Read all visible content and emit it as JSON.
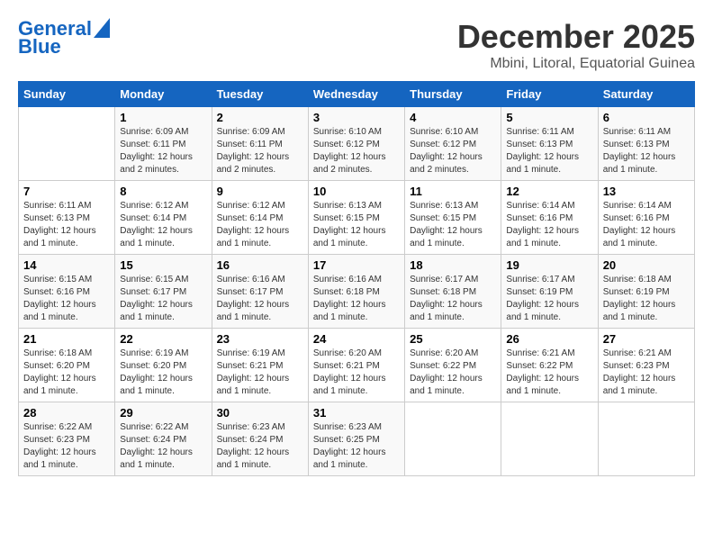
{
  "logo": {
    "line1": "General",
    "line2": "Blue"
  },
  "title": "December 2025",
  "location": "Mbini, Litoral, Equatorial Guinea",
  "weekdays": [
    "Sunday",
    "Monday",
    "Tuesday",
    "Wednesday",
    "Thursday",
    "Friday",
    "Saturday"
  ],
  "weeks": [
    [
      {
        "day": "",
        "info": ""
      },
      {
        "day": "1",
        "info": "Sunrise: 6:09 AM\nSunset: 6:11 PM\nDaylight: 12 hours\nand 2 minutes."
      },
      {
        "day": "2",
        "info": "Sunrise: 6:09 AM\nSunset: 6:11 PM\nDaylight: 12 hours\nand 2 minutes."
      },
      {
        "day": "3",
        "info": "Sunrise: 6:10 AM\nSunset: 6:12 PM\nDaylight: 12 hours\nand 2 minutes."
      },
      {
        "day": "4",
        "info": "Sunrise: 6:10 AM\nSunset: 6:12 PM\nDaylight: 12 hours\nand 2 minutes."
      },
      {
        "day": "5",
        "info": "Sunrise: 6:11 AM\nSunset: 6:13 PM\nDaylight: 12 hours\nand 1 minute."
      },
      {
        "day": "6",
        "info": "Sunrise: 6:11 AM\nSunset: 6:13 PM\nDaylight: 12 hours\nand 1 minute."
      }
    ],
    [
      {
        "day": "7",
        "info": "Sunrise: 6:11 AM\nSunset: 6:13 PM\nDaylight: 12 hours\nand 1 minute."
      },
      {
        "day": "8",
        "info": "Sunrise: 6:12 AM\nSunset: 6:14 PM\nDaylight: 12 hours\nand 1 minute."
      },
      {
        "day": "9",
        "info": "Sunrise: 6:12 AM\nSunset: 6:14 PM\nDaylight: 12 hours\nand 1 minute."
      },
      {
        "day": "10",
        "info": "Sunrise: 6:13 AM\nSunset: 6:15 PM\nDaylight: 12 hours\nand 1 minute."
      },
      {
        "day": "11",
        "info": "Sunrise: 6:13 AM\nSunset: 6:15 PM\nDaylight: 12 hours\nand 1 minute."
      },
      {
        "day": "12",
        "info": "Sunrise: 6:14 AM\nSunset: 6:16 PM\nDaylight: 12 hours\nand 1 minute."
      },
      {
        "day": "13",
        "info": "Sunrise: 6:14 AM\nSunset: 6:16 PM\nDaylight: 12 hours\nand 1 minute."
      }
    ],
    [
      {
        "day": "14",
        "info": "Sunrise: 6:15 AM\nSunset: 6:16 PM\nDaylight: 12 hours\nand 1 minute."
      },
      {
        "day": "15",
        "info": "Sunrise: 6:15 AM\nSunset: 6:17 PM\nDaylight: 12 hours\nand 1 minute."
      },
      {
        "day": "16",
        "info": "Sunrise: 6:16 AM\nSunset: 6:17 PM\nDaylight: 12 hours\nand 1 minute."
      },
      {
        "day": "17",
        "info": "Sunrise: 6:16 AM\nSunset: 6:18 PM\nDaylight: 12 hours\nand 1 minute."
      },
      {
        "day": "18",
        "info": "Sunrise: 6:17 AM\nSunset: 6:18 PM\nDaylight: 12 hours\nand 1 minute."
      },
      {
        "day": "19",
        "info": "Sunrise: 6:17 AM\nSunset: 6:19 PM\nDaylight: 12 hours\nand 1 minute."
      },
      {
        "day": "20",
        "info": "Sunrise: 6:18 AM\nSunset: 6:19 PM\nDaylight: 12 hours\nand 1 minute."
      }
    ],
    [
      {
        "day": "21",
        "info": "Sunrise: 6:18 AM\nSunset: 6:20 PM\nDaylight: 12 hours\nand 1 minute."
      },
      {
        "day": "22",
        "info": "Sunrise: 6:19 AM\nSunset: 6:20 PM\nDaylight: 12 hours\nand 1 minute."
      },
      {
        "day": "23",
        "info": "Sunrise: 6:19 AM\nSunset: 6:21 PM\nDaylight: 12 hours\nand 1 minute."
      },
      {
        "day": "24",
        "info": "Sunrise: 6:20 AM\nSunset: 6:21 PM\nDaylight: 12 hours\nand 1 minute."
      },
      {
        "day": "25",
        "info": "Sunrise: 6:20 AM\nSunset: 6:22 PM\nDaylight: 12 hours\nand 1 minute."
      },
      {
        "day": "26",
        "info": "Sunrise: 6:21 AM\nSunset: 6:22 PM\nDaylight: 12 hours\nand 1 minute."
      },
      {
        "day": "27",
        "info": "Sunrise: 6:21 AM\nSunset: 6:23 PM\nDaylight: 12 hours\nand 1 minute."
      }
    ],
    [
      {
        "day": "28",
        "info": "Sunrise: 6:22 AM\nSunset: 6:23 PM\nDaylight: 12 hours\nand 1 minute."
      },
      {
        "day": "29",
        "info": "Sunrise: 6:22 AM\nSunset: 6:24 PM\nDaylight: 12 hours\nand 1 minute."
      },
      {
        "day": "30",
        "info": "Sunrise: 6:23 AM\nSunset: 6:24 PM\nDaylight: 12 hours\nand 1 minute."
      },
      {
        "day": "31",
        "info": "Sunrise: 6:23 AM\nSunset: 6:25 PM\nDaylight: 12 hours\nand 1 minute."
      },
      {
        "day": "",
        "info": ""
      },
      {
        "day": "",
        "info": ""
      },
      {
        "day": "",
        "info": ""
      }
    ]
  ]
}
